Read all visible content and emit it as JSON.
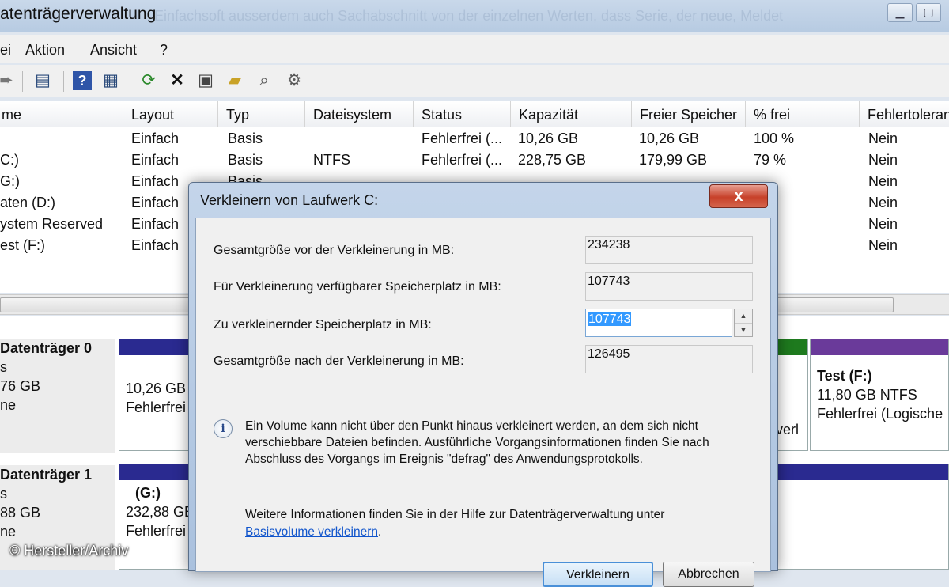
{
  "window": {
    "title": "atenträgerverwaltung",
    "ghost_text": "Einfachsoft ausserdem auch Sachabschnitt von der einzelnen Werten, dass Serie, der neue, Meldet"
  },
  "menu": [
    "ei",
    "Aktion",
    "Ansicht",
    "?"
  ],
  "columns": [
    "me",
    "Layout",
    "Typ",
    "Dateisystem",
    "Status",
    "Kapazität",
    "Freier Speicher",
    "% frei",
    "Fehlertoleranz"
  ],
  "volumes": [
    {
      "name": "",
      "layout": "Einfach",
      "type": "Basis",
      "fs": "",
      "status": "Fehlerfrei (...",
      "capacity": "10,26 GB",
      "free": "10,26 GB",
      "pct": "100 %",
      "fault": "Nein"
    },
    {
      "name": "C:)",
      "layout": "Einfach",
      "type": "Basis",
      "fs": "NTFS",
      "status": "Fehlerfrei (...",
      "capacity": "228,75 GB",
      "free": "179,99 GB",
      "pct": "79 %",
      "fault": "Nein"
    },
    {
      "name": "G:)",
      "layout": "Einfach",
      "type": "Basis",
      "fs": "",
      "status": "",
      "capacity": "",
      "free": "",
      "pct": "",
      "fault": "Nein"
    },
    {
      "name": "aten (D:)",
      "layout": "Einfach",
      "type": "",
      "fs": "",
      "status": "",
      "capacity": "",
      "free": "",
      "pct": "",
      "fault": "Nein"
    },
    {
      "name": "ystem Reserved",
      "layout": "Einfach",
      "type": "",
      "fs": "",
      "status": "",
      "capacity": "",
      "free": "",
      "pct": "",
      "fault": "Nein"
    },
    {
      "name": "est (F:)",
      "layout": "Einfach",
      "type": "",
      "fs": "",
      "status": "",
      "capacity": "",
      "free": "",
      "pct": "",
      "fault": "Nein"
    }
  ],
  "disks": [
    {
      "name": "Datenträger 0",
      "line2": "s",
      "line3": "76 GB",
      "line4": "ne",
      "partA": {
        "line1": "10,26 GB",
        "line2": "Fehlerfrei"
      },
      "partB": {
        "line1": "verl"
      },
      "partC": {
        "title": "Test  (F:)",
        "line1": "11,80 GB NTFS",
        "line2": "Fehlerfrei (Logische"
      }
    },
    {
      "name": "Datenträger 1",
      "line2": "s",
      "line3": "88 GB",
      "line4": "ne",
      "partA": {
        "title": "(G:)",
        "line1": "232,88 GE",
        "line2": "Fehlerfrei"
      }
    }
  ],
  "watermark": "© Hersteller/Archiv",
  "dialog": {
    "title": "Verkleinern von Laufwerk C:",
    "close": "x",
    "total_before_label": "Gesamtgröße vor der Verkleinerung in MB:",
    "total_before_value": "234238",
    "available_label": "Für Verkleinerung verfügbarer Speicherplatz in MB:",
    "available_value": "107743",
    "shrink_label": "Zu verkleinernder Speicherplatz in MB:",
    "shrink_value": "107743",
    "total_after_label": "Gesamtgröße nach der Verkleinerung in MB:",
    "total_after_value": "126495",
    "info": "Ein Volume kann nicht über den Punkt hinaus verkleinert werden, an dem sich nicht verschiebbare Dateien befinden. Ausführliche Vorgangsinformationen finden Sie nach Abschluss des Vorgangs im Ereignis \"defrag\" des Anwendungsprotokolls.",
    "more_info": "Weitere Informationen finden Sie in der Hilfe zur Datenträgerverwaltung unter",
    "link": "Basisvolume verkleinern",
    "link_suffix": ".",
    "ok": "Verkleinern",
    "cancel": "Abbrechen"
  },
  "icons": [
    "back-arrow-icon",
    "console-tree-icon",
    "help-icon",
    "properties-view-icon",
    "refresh-icon",
    "delete-icon",
    "properties-icon",
    "open-icon",
    "explore-icon",
    "settings-icon"
  ]
}
